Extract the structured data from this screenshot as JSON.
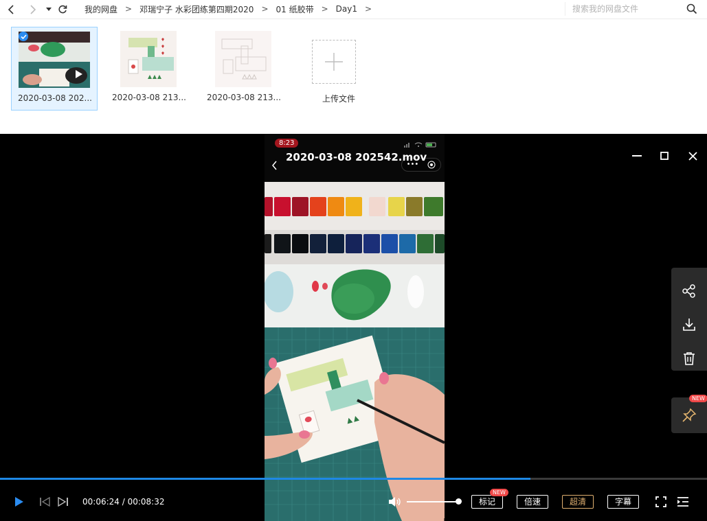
{
  "navigation": {
    "breadcrumbs": [
      "我的网盘",
      "邓瑞宁子 水彩团练第四期2020",
      "01 纸胶带",
      "Day1"
    ],
    "search_placeholder": "搜索我的网盘文件"
  },
  "files": [
    {
      "name": "2020-03-08 202...",
      "kind": "video",
      "selected": true
    },
    {
      "name": "2020-03-08 213...",
      "kind": "image",
      "selected": false
    },
    {
      "name": "2020-03-08 213...",
      "kind": "image",
      "selected": false
    }
  ],
  "upload": {
    "label": "上传文件"
  },
  "player": {
    "title": "2020-03-08 202542.mov",
    "phone_time": "8:23",
    "current_time": "00:06:24",
    "total_time": "00:08:32",
    "time_display": "00:06:24 / 00:08:32",
    "progress_fraction": 0.75,
    "volume_fraction": 1.0,
    "buttons": {
      "bookmark": "标记",
      "speed": "倍速",
      "quality": "超清",
      "subtitle": "字幕"
    },
    "badges": {
      "bookmark_new": "NEW",
      "pin_new": "NEW"
    }
  },
  "colors": {
    "accent": "#1e88e5",
    "quality_gold": "#e0b070",
    "badge_red": "#f04848",
    "selection_bg": "#e5f3ff"
  }
}
